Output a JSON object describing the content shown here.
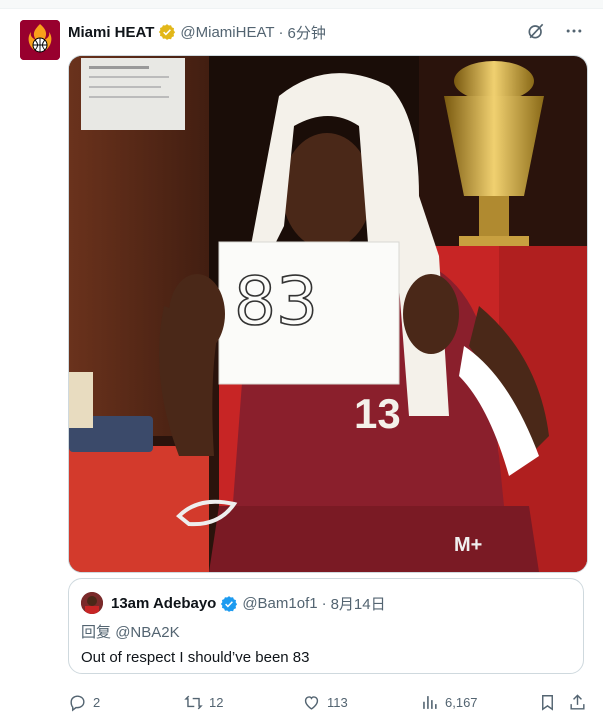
{
  "tweet": {
    "author_name": "Miami HEAT",
    "author_handle": "@MiamiHEAT",
    "separator": "·",
    "time": "6分钟",
    "brand_color": "#98002e",
    "verified_color": "#e2b719"
  },
  "media": {
    "sign_text": "83",
    "jersey_number": "13",
    "shorts_logo": "M+",
    "colors": {
      "jersey": "#8a1f2c",
      "towel": "#f4f1ea",
      "chair": "#c72525",
      "wall": "#3a1c12"
    }
  },
  "quote": {
    "author_name": "13am Adebayo",
    "author_handle": "@Bam1of1",
    "separator": "·",
    "date": "8月14日",
    "reply_prefix": "回复",
    "reply_mention": "@NBA2K",
    "text": "Out of respect I should’ve been 83",
    "verified_color": "#1d9bf0"
  },
  "actions": {
    "replies": "2",
    "reposts": "12",
    "likes": "113",
    "views": "6,167"
  },
  "icons": [
    "more-icon",
    "grok-icon",
    "reply-icon",
    "repost-icon",
    "like-icon",
    "views-icon",
    "bookmark-icon",
    "share-icon"
  ]
}
